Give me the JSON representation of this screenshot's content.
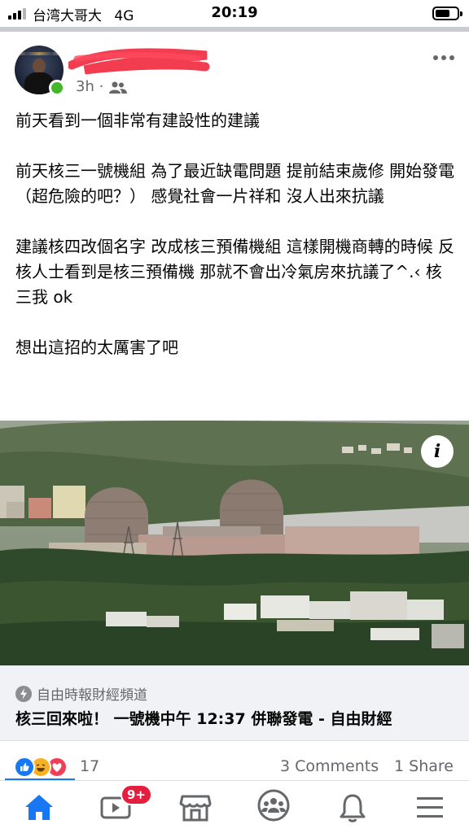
{
  "status_bar": {
    "carrier": "台湾大哥大",
    "network": "4G",
    "time": "20:19"
  },
  "post": {
    "time": "3h",
    "audience_icon": "friends-icon",
    "paragraphs": [
      "前天看到一個非常有建設性的建議",
      "前天核三一號機組 為了最近缺電問題 提前結束歲修 開始發電（超危險的吧？） 感覺社會一片祥和 沒人出來抗議",
      "建議核四改個名字 改成核三預備機組 這樣開機商轉的時候 反核人士看到是核三預備機 那就不會出冷氣房來抗議了^.‹ 核三我 ok",
      "想出這招的太厲害了吧"
    ]
  },
  "link_preview": {
    "source": "自由時報財經頻道",
    "title": "核三回來啦！ 一號機中午 12:37 併聯發電 - 自由財經"
  },
  "engagement": {
    "reaction_count": "17",
    "comments": "3 Comments",
    "shares": "1 Share"
  },
  "tab_bar": {
    "watch_badge": "9+",
    "tabs": [
      "home-icon",
      "watch-icon",
      "marketplace-icon",
      "groups-icon",
      "notifications-icon",
      "menu-icon"
    ]
  },
  "colors": {
    "accent": "#1877f2",
    "badge": "#e41e3f",
    "online": "#42b72a",
    "secondary_text": "#65676b"
  }
}
